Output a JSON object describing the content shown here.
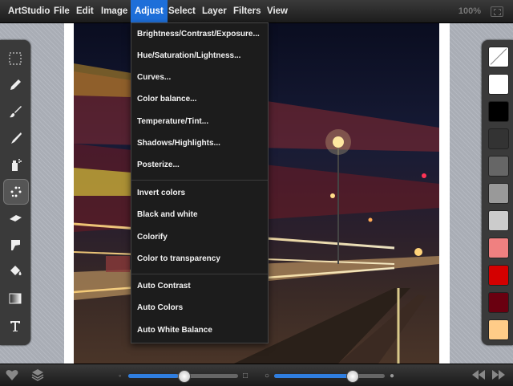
{
  "app": {
    "title": "ArtStudio"
  },
  "menu": {
    "file": "File",
    "edit": "Edit",
    "image": "Image",
    "adjust": "Adjust",
    "select": "Select",
    "layer": "Layer",
    "filters": "Filters",
    "view": "View"
  },
  "zoom": "100%",
  "adjust_menu": {
    "items": [
      "Brightness/Contrast/Exposure...",
      "Hue/Saturation/Lightness...",
      "Curves...",
      "Color balance...",
      "Temperature/Tint...",
      "Shadows/Highlights...",
      "Posterize...",
      "Invert colors",
      "Black and white",
      "Colorify",
      "Color to transparency",
      "Auto Contrast",
      "Auto Colors",
      "Auto White Balance"
    ]
  },
  "tools": [
    "selection-rect-icon",
    "pencil-icon",
    "brush-icon",
    "smudge-icon",
    "spray-icon",
    "dots-brush-icon",
    "eraser-icon",
    "clone-icon",
    "paint-bucket-icon",
    "gradient-icon",
    "text-icon"
  ],
  "selected_tool": "dots-brush-icon",
  "palette": [
    "none",
    "#ffffff",
    "#000000",
    "#333333",
    "#666666",
    "#999999",
    "#cccccc",
    "#f08080",
    "#d40000",
    "#6a0010",
    "#ffcc88"
  ],
  "sliders": {
    "brush_size": 0.45,
    "opacity": 0.7
  },
  "accent": "#1e6fd9"
}
